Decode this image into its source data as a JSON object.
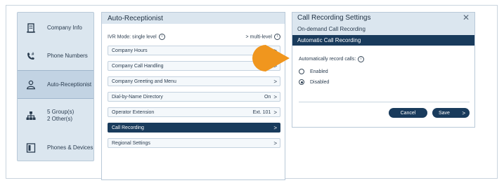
{
  "nav": {
    "items": [
      {
        "label": "Company Info",
        "icon": "building-icon"
      },
      {
        "label": "Phone Numbers",
        "icon": "phone-number-icon"
      },
      {
        "label": "Auto-Receptionist",
        "icon": "receptionist-icon",
        "active": true
      },
      {
        "label": "5 Group(s)",
        "label2": "2 Other(s)",
        "icon": "groups-icon"
      },
      {
        "label": "Phones & Devices",
        "icon": "devices-icon"
      }
    ]
  },
  "auto_receptionist": {
    "title": "Auto-Receptionist",
    "ivr_label": "IVR Mode: single level",
    "ivr_value": "multi-level",
    "rows": [
      {
        "label": "Company Hours",
        "value": ""
      },
      {
        "label": "Company Call Handling",
        "value": ""
      },
      {
        "label": "Company Greeting and Menu",
        "value": ""
      },
      {
        "label": "Dial-by-Name Directory",
        "value": "On"
      },
      {
        "label": "Operator Extension",
        "value": "Ext. 101"
      },
      {
        "label": "Call Recording",
        "value": "",
        "active": true
      },
      {
        "label": "Regional Settings",
        "value": ""
      }
    ]
  },
  "call_recording": {
    "title": "Call Recording Settings",
    "subtitle": "On-demand Call Recording",
    "section_header": "Automatic Call Recording",
    "auto_label": "Automatically record calls:",
    "options": [
      {
        "label": "Enabled",
        "selected": false
      },
      {
        "label": "Disabled",
        "selected": true
      }
    ],
    "cancel_label": "Cancel",
    "save_label": "Save"
  },
  "colors": {
    "accent_dark": "#193b5c",
    "panel_bg": "#dbe6ef",
    "callout": "#f0961e"
  }
}
